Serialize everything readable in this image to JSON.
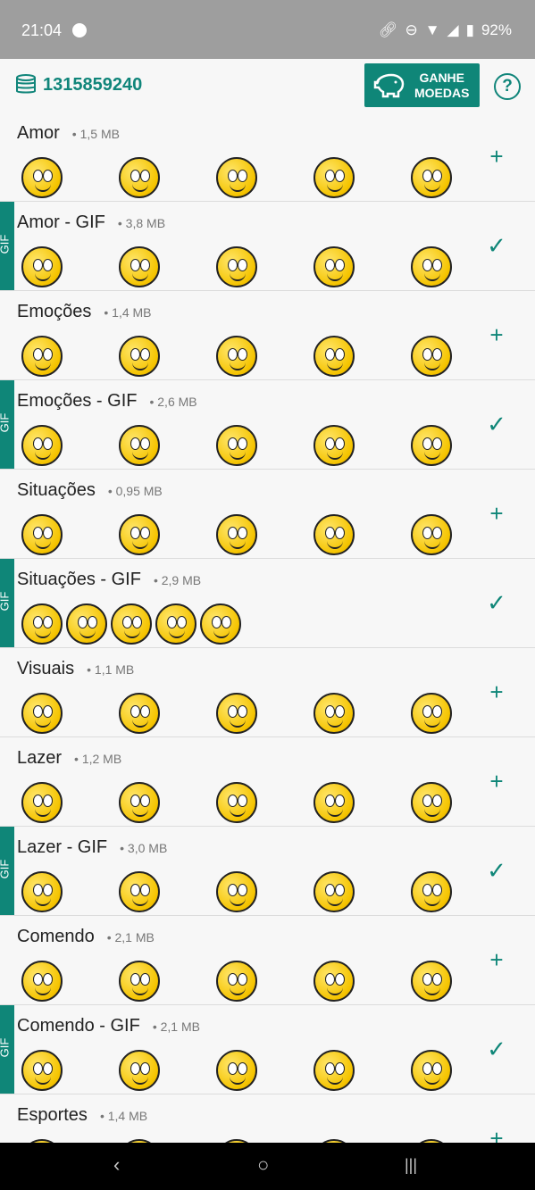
{
  "status": {
    "time": "21:04",
    "battery": "92%"
  },
  "header": {
    "coins": "1315859240",
    "earn_label_1": "GANHE",
    "earn_label_2": "MOEDAS",
    "help": "?"
  },
  "colors": {
    "accent": "#0f8678",
    "face": "#f5c400"
  },
  "packs": [
    {
      "title": "Amor",
      "size": "• 1,5 MB",
      "gif": false,
      "installed": false,
      "count": 5
    },
    {
      "title": "Amor - GIF",
      "size": "• 3,8 MB",
      "gif": true,
      "installed": true,
      "count": 5
    },
    {
      "title": "Emoções",
      "size": "• 1,4 MB",
      "gif": false,
      "installed": false,
      "count": 5
    },
    {
      "title": "Emoções - GIF",
      "size": "• 2,6 MB",
      "gif": true,
      "installed": true,
      "count": 5
    },
    {
      "title": "Situações",
      "size": "• 0,95 MB",
      "gif": false,
      "installed": false,
      "count": 5
    },
    {
      "title": "Situações - GIF",
      "size": "• 2,9 MB",
      "gif": true,
      "installed": true,
      "count": 5
    },
    {
      "title": "Visuais",
      "size": "• 1,1 MB",
      "gif": false,
      "installed": false,
      "count": 5
    },
    {
      "title": "Lazer",
      "size": "• 1,2 MB",
      "gif": false,
      "installed": false,
      "count": 5
    },
    {
      "title": "Lazer - GIF",
      "size": "• 3,0 MB",
      "gif": true,
      "installed": true,
      "count": 5
    },
    {
      "title": "Comendo",
      "size": "• 2,1 MB",
      "gif": false,
      "installed": false,
      "count": 5
    },
    {
      "title": "Comendo - GIF",
      "size": "• 2,1 MB",
      "gif": true,
      "installed": true,
      "count": 5
    },
    {
      "title": "Esportes",
      "size": "• 1,4 MB",
      "gif": false,
      "installed": false,
      "count": 5
    }
  ],
  "gif_label": "GIF"
}
